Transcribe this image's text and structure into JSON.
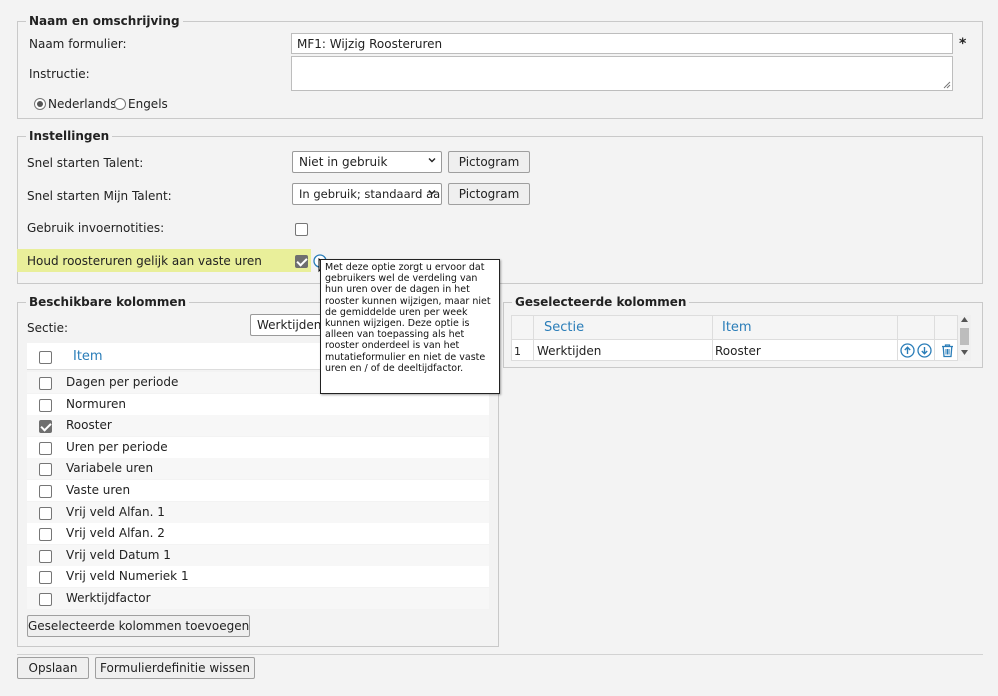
{
  "section_naam": {
    "legend": "Naam en omschrijving",
    "naam_label": "Naam formulier:",
    "naam_value": "MF1: Wijzig Roosteruren",
    "required_marker": "*",
    "instructie_label": "Instructie:",
    "instructie_value": "",
    "languages": [
      {
        "label": "Nederlands",
        "selected": true
      },
      {
        "label": "Engels",
        "selected": false
      }
    ]
  },
  "section_instellingen": {
    "legend": "Instellingen",
    "snel_talent_label": "Snel starten Talent:",
    "snel_talent_value": "Niet in gebruik",
    "snel_mijn_label": "Snel starten Mijn Talent:",
    "snel_mijn_value": "In gebruik; standaard aan",
    "pictogram_label": "Pictogram",
    "gebruik_label": "Gebruik invoernotities:",
    "gebruik_checked": false,
    "houd_label": "Houd roosteruren gelijk aan vaste uren",
    "houd_checked": true,
    "highlight_color": "#e9ef9a",
    "tooltip_text": "Met deze optie zorgt u ervoor dat gebruikers wel de verdeling van hun uren over de dagen in het rooster kunnen wijzigen, maar niet de gemiddelde uren per week kunnen wijzigen. Deze optie is alleen van toepassing als het rooster onderdeel is van het mutatieformulier en niet de vaste uren en / of de deeltijdfactor."
  },
  "beschikbare": {
    "legend": "Beschikbare kolommen",
    "sectie_label": "Sectie:",
    "sectie_value": "Werktijden",
    "header_item": "Item",
    "items": [
      {
        "label": "Dagen per periode",
        "checked": false
      },
      {
        "label": "Normuren",
        "checked": false
      },
      {
        "label": "Rooster",
        "checked": true
      },
      {
        "label": "Uren per periode",
        "checked": false
      },
      {
        "label": "Variabele uren",
        "checked": false
      },
      {
        "label": "Vaste uren",
        "checked": false
      },
      {
        "label": "Vrij veld Alfan. 1",
        "checked": false
      },
      {
        "label": "Vrij veld Alfan. 2",
        "checked": false
      },
      {
        "label": "Vrij veld Datum 1",
        "checked": false
      },
      {
        "label": "Vrij veld Numeriek 1",
        "checked": false
      },
      {
        "label": "Werktijdfactor",
        "checked": false
      }
    ],
    "add_button": "Geselecteerde kolommen toevoegen"
  },
  "geselecteerde": {
    "legend": "Geselecteerde kolommen",
    "header_sectie": "Sectie",
    "header_item": "Item",
    "rows": [
      {
        "num": "1",
        "sectie": "Werktijden",
        "item": "Rooster"
      }
    ]
  },
  "footer": {
    "save_label": "Opslaan",
    "clear_label": "Formulierdefinitie wissen"
  },
  "colors": {
    "accent_blue": "#2a7db8",
    "background": "#f3f3f3"
  }
}
